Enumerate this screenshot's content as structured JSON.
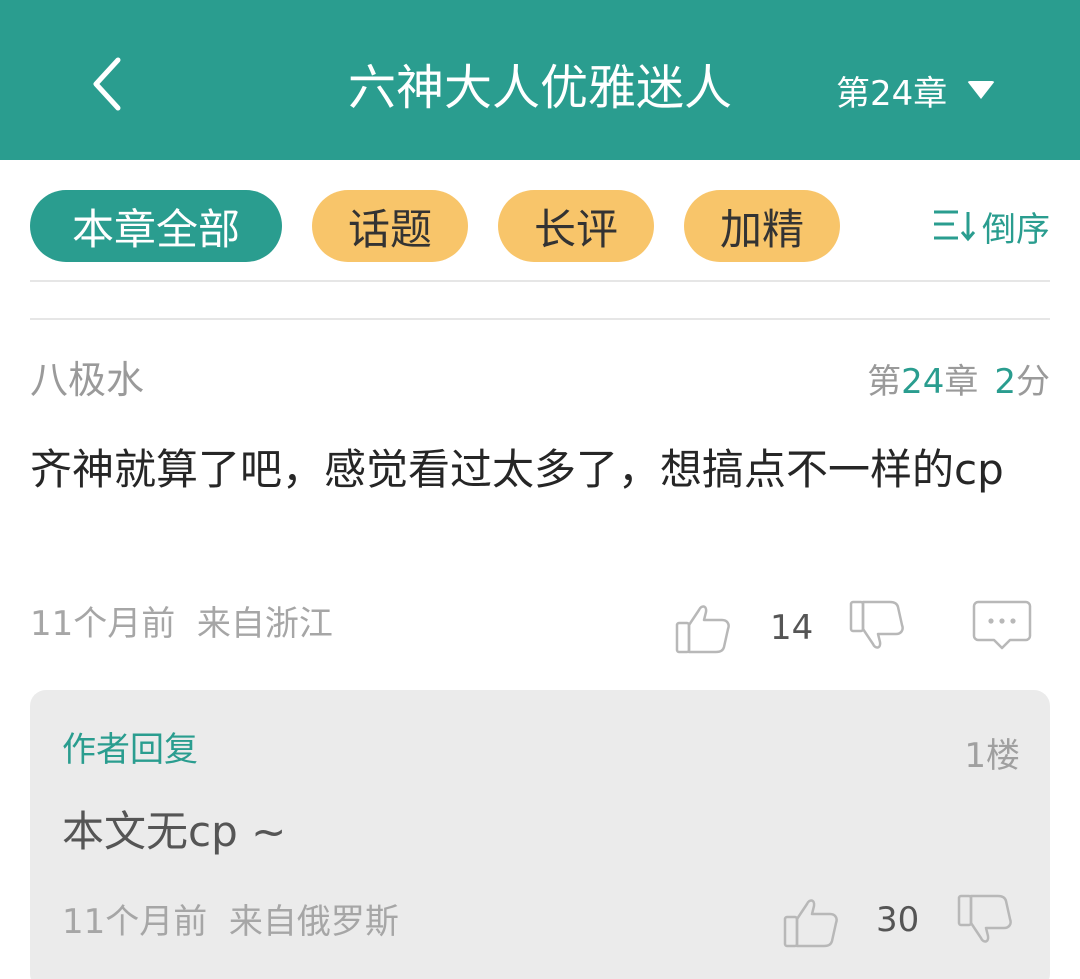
{
  "header": {
    "back_icon": "chevron-left-icon",
    "title": "六神大人优雅迷人",
    "chapter_label": "第24章",
    "dropdown_icon": "triangle-down-icon",
    "background_color": "#2a9d8f"
  },
  "filters": {
    "chips": [
      {
        "label": "本章全部",
        "active": true
      },
      {
        "label": "话题",
        "active": false
      },
      {
        "label": "长评",
        "active": false
      },
      {
        "label": "加精",
        "active": false
      }
    ],
    "sort_label": "倒序",
    "sort_icon": "sort-icon"
  },
  "comment": {
    "username": "八极水",
    "chapter_prefix": "第",
    "chapter_number": "24",
    "chapter_suffix": "章",
    "score_number": "2",
    "score_suffix": "分",
    "text": "齐神就算了吧，感觉看过太多了，想搞点不一样的cp",
    "time": "11个月前",
    "location": "来自浙江",
    "like_count": "14"
  },
  "reply": {
    "label": "作者回复",
    "floor": "1楼",
    "text": "本文无cp ~",
    "time": "11个月前",
    "location": "来自俄罗斯",
    "like_count": "30"
  },
  "colors": {
    "accent": "#2a9d8f",
    "tag_chip": "#f8c56a",
    "reply_background": "#ebebeb"
  }
}
